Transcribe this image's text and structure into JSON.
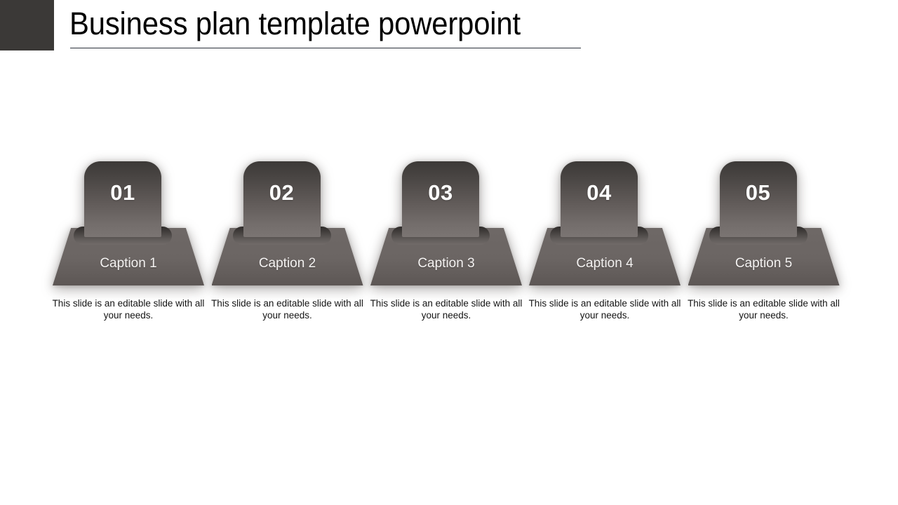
{
  "slide": {
    "title": "Business plan template powerpoint",
    "background_color": "#ffffff",
    "corner_swatch_color": "#3b3937",
    "title_rule_color": "#2a2f3a",
    "title_color": "#000000"
  },
  "theme": {
    "shape_top_color": "#3c3937",
    "shape_bottom_color": "#7b7573",
    "base_color": "#6b6563",
    "lip_dark_color": "#2e2b2a",
    "number_text_color": "#ffffff",
    "caption_text_color": "#f4f2f1",
    "description_text_color": "#141414"
  },
  "steps": [
    {
      "number": "01",
      "caption": "Caption 1",
      "description": "This slide is an editable slide with all your needs."
    },
    {
      "number": "02",
      "caption": "Caption 2",
      "description": "This slide is an editable slide with all your needs."
    },
    {
      "number": "03",
      "caption": "Caption 3",
      "description": "This slide is an editable slide with all your needs."
    },
    {
      "number": "04",
      "caption": "Caption 4",
      "description": "This slide is an editable slide with all your needs."
    },
    {
      "number": "05",
      "caption": "Caption 5",
      "description": "This slide is an editable slide with all your needs."
    }
  ]
}
